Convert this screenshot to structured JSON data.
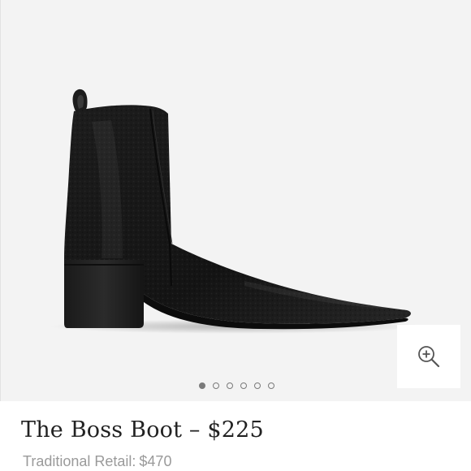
{
  "product": {
    "title": "The Boss Boot – $225",
    "traditional_retail_label": "Traditional Retail:",
    "traditional_retail_price": "$470"
  },
  "gallery": {
    "image_count": 6,
    "active_index": 0,
    "zoom_icon": "zoom-in-icon",
    "image_subject": "black pebbled leather ankle boot with pointed toe, block heel and pull tab"
  },
  "colors": {
    "gallery_background": "#f3f3f3",
    "boot_leather": "#1b1b1b",
    "dot_indicator": "#7a7a7a",
    "title_text": "#222222",
    "retail_text": "#9a9a9a"
  }
}
